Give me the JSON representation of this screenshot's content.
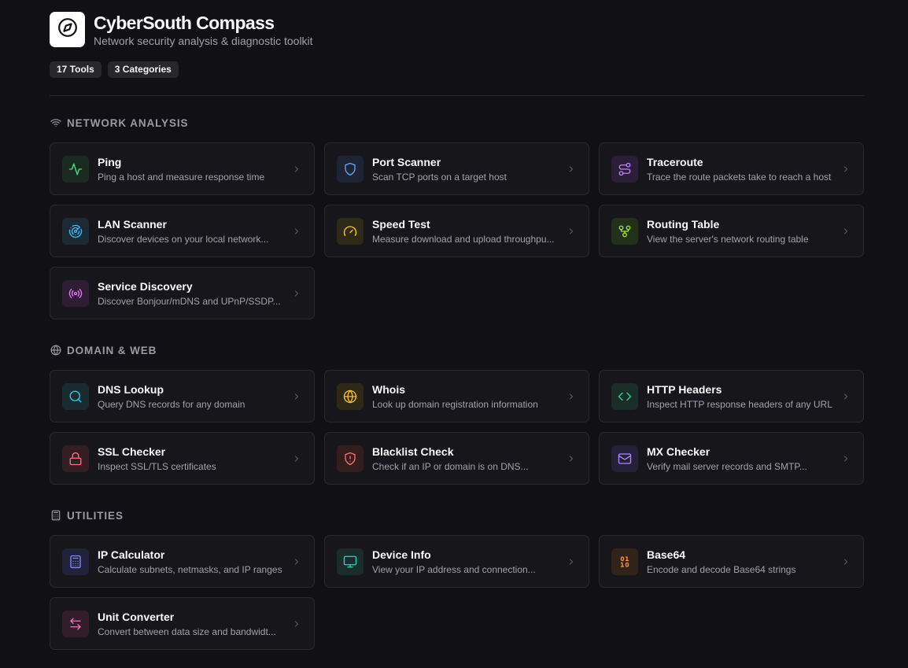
{
  "app": {
    "title": "CyberSouth Compass",
    "subtitle": "Network security analysis & diagnostic toolkit",
    "logo_icon": "compass-icon",
    "badges": [
      "17 Tools",
      "3 Categories"
    ]
  },
  "sections": [
    {
      "title": "NETWORK ANALYSIS",
      "icon": "wifi-icon",
      "tools": [
        {
          "name": "Ping",
          "desc": "Ping a host and measure response time",
          "icon": "activity-icon",
          "color": "#4ade80",
          "bg": "#1c2b22"
        },
        {
          "name": "Port Scanner",
          "desc": "Scan TCP ports on a target host",
          "icon": "shield-icon",
          "color": "#60a5fa",
          "bg": "#1d2535"
        },
        {
          "name": "Traceroute",
          "desc": "Trace the route packets take to reach a host",
          "icon": "route-icon",
          "color": "#c084fc",
          "bg": "#2a1f36"
        },
        {
          "name": "LAN Scanner",
          "desc": "Discover devices on your local network...",
          "icon": "radar-icon",
          "color": "#38bdf8",
          "bg": "#1b2a33"
        },
        {
          "name": "Speed Test",
          "desc": "Measure download and upload throughpu...",
          "icon": "gauge-icon",
          "color": "#facc15",
          "bg": "#2e2a18"
        },
        {
          "name": "Routing Table",
          "desc": "View the server's network routing table",
          "icon": "git-fork-icon",
          "color": "#a3e635",
          "bg": "#23301a"
        },
        {
          "name": "Service Discovery",
          "desc": "Discover Bonjour/mDNS and UPnP/SSDP...",
          "icon": "broadcast-icon",
          "color": "#e879f9",
          "bg": "#2e1d33"
        }
      ]
    },
    {
      "title": "DOMAIN & WEB",
      "icon": "globe-icon",
      "tools": [
        {
          "name": "DNS Lookup",
          "desc": "Query DNS records for any domain",
          "icon": "search-icon",
          "color": "#22d3ee",
          "bg": "#1a2b30"
        },
        {
          "name": "Whois",
          "desc": "Look up domain registration information",
          "icon": "globe-icon",
          "color": "#fbbf24",
          "bg": "#2e2818"
        },
        {
          "name": "HTTP Headers",
          "desc": "Inspect HTTP response headers of any URL",
          "icon": "code-icon",
          "color": "#34d399",
          "bg": "#1a2d26"
        },
        {
          "name": "SSL Checker",
          "desc": "Inspect SSL/TLS certificates",
          "icon": "lock-icon",
          "color": "#fb7185",
          "bg": "#321e23"
        },
        {
          "name": "Blacklist Check",
          "desc": "Check if an IP or domain is on DNS...",
          "icon": "shield-alert-icon",
          "color": "#f87171",
          "bg": "#331e1e"
        },
        {
          "name": "MX Checker",
          "desc": "Verify mail server records and SMTP...",
          "icon": "mail-icon",
          "color": "#a78bfa",
          "bg": "#261f38"
        }
      ]
    },
    {
      "title": "UTILITIES",
      "icon": "calculator-icon",
      "tools": [
        {
          "name": "IP Calculator",
          "desc": "Calculate subnets, netmasks, and IP ranges",
          "icon": "calculator-icon",
          "color": "#818cf8",
          "bg": "#22213a"
        },
        {
          "name": "Device Info",
          "desc": "View your IP address and connection...",
          "icon": "monitor-icon",
          "color": "#2dd4bf",
          "bg": "#1a2d2b"
        },
        {
          "name": "Base64",
          "desc": "Encode and decode Base64 strings",
          "icon": "binary-icon",
          "color": "#fb923c",
          "bg": "#30231a"
        },
        {
          "name": "Unit Converter",
          "desc": "Convert between data size and bandwidt...",
          "icon": "arrow-left-right-icon",
          "color": "#f472b6",
          "bg": "#321e2b"
        }
      ]
    }
  ]
}
